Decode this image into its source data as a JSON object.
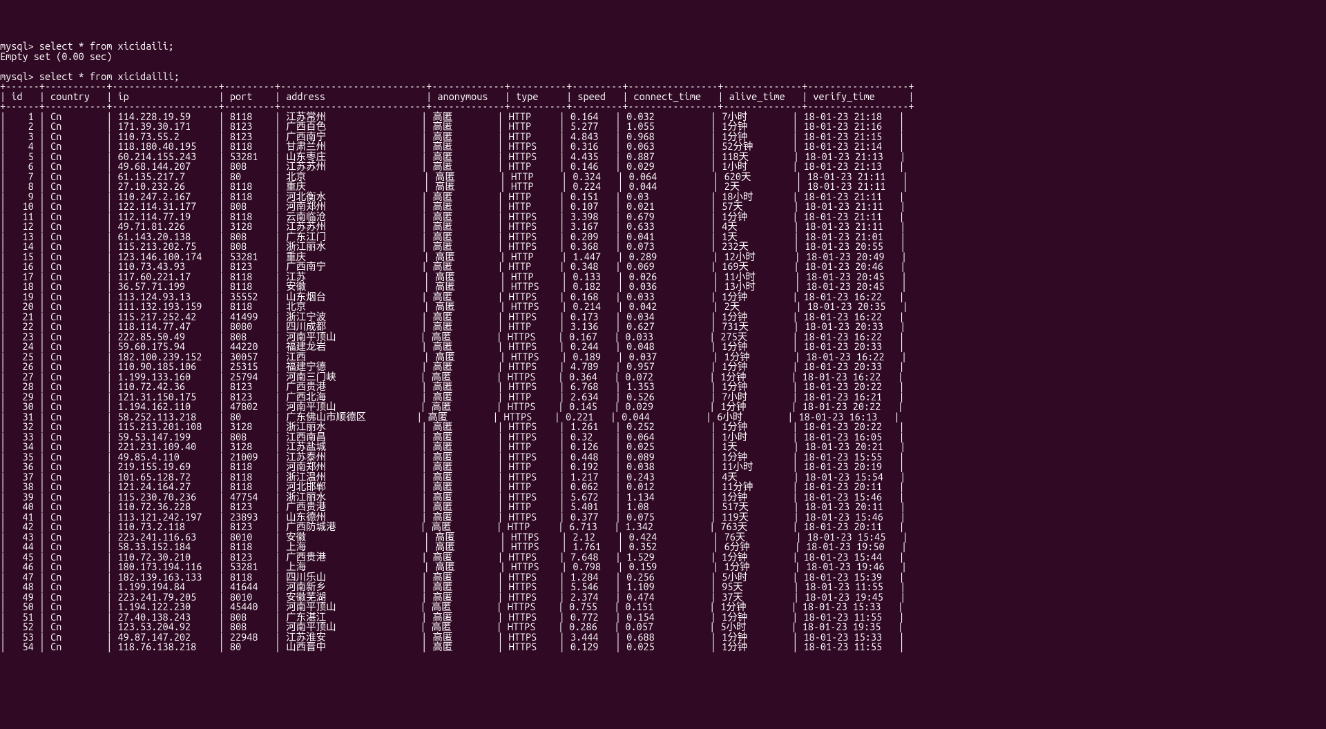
{
  "prompt1": "mysql> select * from xicidaili;",
  "result1": "Empty set (0.00 sec)",
  "blank": "",
  "prompt2": "mysql> select * from xicidailli;",
  "columns": [
    "id",
    "country",
    "ip",
    "port",
    "address",
    "anonymous",
    "type",
    "speed",
    "connect_time",
    "alive_time",
    "verify_time"
  ],
  "widths": {
    "id": 4,
    "country": 9,
    "ip": 17,
    "port": 7,
    "address": 24,
    "anonymous": 11,
    "type": 8,
    "speed": 7,
    "connect_time": 14,
    "alive_time": 12,
    "verify_time": 16
  },
  "rows": [
    {
      "id": "1",
      "country": "Cn",
      "ip": "114.228.19.59",
      "port": "8118",
      "address": "江苏常州",
      "anonymous": "高匿",
      "type": "HTTP",
      "speed": "0.164",
      "connect_time": "0.032",
      "alive_time": "7小时",
      "verify_time": "18-01-23 21:18"
    },
    {
      "id": "2",
      "country": "Cn",
      "ip": "171.39.30.171",
      "port": "8123",
      "address": "广西百色",
      "anonymous": "高匿",
      "type": "HTTP",
      "speed": "5.277",
      "connect_time": "1.055",
      "alive_time": "1分钟",
      "verify_time": "18-01-23 21:16"
    },
    {
      "id": "3",
      "country": "Cn",
      "ip": "110.73.55.2",
      "port": "8123",
      "address": "广西南宁",
      "anonymous": "高匿",
      "type": "HTTP",
      "speed": "4.843",
      "connect_time": "0.968",
      "alive_time": "1分钟",
      "verify_time": "18-01-23 21:15"
    },
    {
      "id": "4",
      "country": "Cn",
      "ip": "118.180.40.195",
      "port": "8118",
      "address": "甘肃兰州",
      "anonymous": "高匿",
      "type": "HTTPS",
      "speed": "0.316",
      "connect_time": "0.063",
      "alive_time": "52分钟",
      "verify_time": "18-01-23 21:14"
    },
    {
      "id": "5",
      "country": "Cn",
      "ip": "60.214.155.243",
      "port": "53281",
      "address": "山东枣庄",
      "anonymous": "高匿",
      "type": "HTTPS",
      "speed": "4.435",
      "connect_time": "0.887",
      "alive_time": "118天",
      "verify_time": "18-01-23 21:13"
    },
    {
      "id": "6",
      "country": "Cn",
      "ip": "49.68.144.207",
      "port": "808",
      "address": "江苏苏州",
      "anonymous": "高匿",
      "type": "HTTP",
      "speed": "0.146",
      "connect_time": "0.029",
      "alive_time": "1小时",
      "verify_time": "18-01-23 21:13"
    },
    {
      "id": "7",
      "country": "Cn",
      "ip": "61.135.217.7",
      "port": "80",
      "address": "北京",
      "anonymous": "高匿",
      "type": "HTTP",
      "speed": "0.324",
      "connect_time": "0.064",
      "alive_time": "620天",
      "verify_time": "18-01-23 21:11"
    },
    {
      "id": "8",
      "country": "Cn",
      "ip": "27.10.232.26",
      "port": "8118",
      "address": "重庆",
      "anonymous": "高匿",
      "type": "HTTP",
      "speed": "0.224",
      "connect_time": "0.044",
      "alive_time": "2天",
      "verify_time": "18-01-23 21:11"
    },
    {
      "id": "9",
      "country": "Cn",
      "ip": "110.247.2.167",
      "port": "8118",
      "address": "河北衡水",
      "anonymous": "高匿",
      "type": "HTTP",
      "speed": "0.151",
      "connect_time": "0.03",
      "alive_time": "18小时",
      "verify_time": "18-01-23 21:11"
    },
    {
      "id": "10",
      "country": "Cn",
      "ip": "122.114.31.177",
      "port": "808",
      "address": "河南郑州",
      "anonymous": "高匿",
      "type": "HTTP",
      "speed": "0.107",
      "connect_time": "0.021",
      "alive_time": "57天",
      "verify_time": "18-01-23 21:11"
    },
    {
      "id": "11",
      "country": "Cn",
      "ip": "112.114.77.19",
      "port": "8118",
      "address": "云南临沧",
      "anonymous": "高匿",
      "type": "HTTPS",
      "speed": "3.398",
      "connect_time": "0.679",
      "alive_time": "1分钟",
      "verify_time": "18-01-23 21:11"
    },
    {
      "id": "12",
      "country": "Cn",
      "ip": "49.71.81.226",
      "port": "3128",
      "address": "江苏苏州",
      "anonymous": "高匿",
      "type": "HTTPS",
      "speed": "3.167",
      "connect_time": "0.633",
      "alive_time": "4天",
      "verify_time": "18-01-23 21:11"
    },
    {
      "id": "13",
      "country": "Cn",
      "ip": "61.143.20.138",
      "port": "808",
      "address": "广东江门",
      "anonymous": "高匿",
      "type": "HTTPS",
      "speed": "0.209",
      "connect_time": "0.041",
      "alive_time": "1天",
      "verify_time": "18-01-23 21:01"
    },
    {
      "id": "14",
      "country": "Cn",
      "ip": "115.213.202.75",
      "port": "808",
      "address": "浙江丽水",
      "anonymous": "高匿",
      "type": "HTTPS",
      "speed": "0.368",
      "connect_time": "0.073",
      "alive_time": "232天",
      "verify_time": "18-01-23 20:55"
    },
    {
      "id": "15",
      "country": "Cn",
      "ip": "123.146.100.174",
      "port": "53281",
      "address": "重庆",
      "anonymous": "高匿",
      "type": "HTTP",
      "speed": "1.447",
      "connect_time": "0.289",
      "alive_time": "12小时",
      "verify_time": "18-01-23 20:49"
    },
    {
      "id": "16",
      "country": "Cn",
      "ip": "110.73.43.93",
      "port": "8123",
      "address": "广西南宁",
      "anonymous": "高匿",
      "type": "HTTP",
      "speed": "0.348",
      "connect_time": "0.069",
      "alive_time": "169天",
      "verify_time": "18-01-23 20:46"
    },
    {
      "id": "17",
      "country": "Cn",
      "ip": "117.60.221.17",
      "port": "8118",
      "address": "江苏",
      "anonymous": "高匿",
      "type": "HTTP",
      "speed": "0.133",
      "connect_time": "0.026",
      "alive_time": "11小时",
      "verify_time": "18-01-23 20:45"
    },
    {
      "id": "18",
      "country": "Cn",
      "ip": "36.57.71.199",
      "port": "8118",
      "address": "安徽",
      "anonymous": "高匿",
      "type": "HTTPS",
      "speed": "0.182",
      "connect_time": "0.036",
      "alive_time": "13小时",
      "verify_time": "18-01-23 20:45"
    },
    {
      "id": "19",
      "country": "Cn",
      "ip": "113.124.93.13",
      "port": "35552",
      "address": "山东烟台",
      "anonymous": "高匿",
      "type": "HTTPS",
      "speed": "0.168",
      "connect_time": "0.033",
      "alive_time": "1分钟",
      "verify_time": "18-01-23 16:22"
    },
    {
      "id": "20",
      "country": "Cn",
      "ip": "111.132.193.159",
      "port": "8118",
      "address": "北京",
      "anonymous": "高匿",
      "type": "HTTPS",
      "speed": "0.214",
      "connect_time": "0.042",
      "alive_time": "2天",
      "verify_time": "18-01-23 20:35"
    },
    {
      "id": "21",
      "country": "Cn",
      "ip": "115.217.252.42",
      "port": "41499",
      "address": "浙江宁波",
      "anonymous": "高匿",
      "type": "HTTPS",
      "speed": "0.173",
      "connect_time": "0.034",
      "alive_time": "1分钟",
      "verify_time": "18-01-23 16:22"
    },
    {
      "id": "22",
      "country": "Cn",
      "ip": "118.114.77.47",
      "port": "8080",
      "address": "四川成都",
      "anonymous": "高匿",
      "type": "HTTP",
      "speed": "3.136",
      "connect_time": "0.627",
      "alive_time": "731天",
      "verify_time": "18-01-23 20:33"
    },
    {
      "id": "23",
      "country": "Cn",
      "ip": "222.85.50.49",
      "port": "808",
      "address": "河南平顶山",
      "anonymous": "高匿",
      "type": "HTTPS",
      "speed": "0.167",
      "connect_time": "0.033",
      "alive_time": "275天",
      "verify_time": "18-01-23 16:22"
    },
    {
      "id": "24",
      "country": "Cn",
      "ip": "59.60.175.94",
      "port": "44220",
      "address": "福建龙岩",
      "anonymous": "高匿",
      "type": "HTTPS",
      "speed": "0.244",
      "connect_time": "0.048",
      "alive_time": "1分钟",
      "verify_time": "18-01-23 20:33"
    },
    {
      "id": "25",
      "country": "Cn",
      "ip": "182.100.239.152",
      "port": "30057",
      "address": "江西",
      "anonymous": "高匿",
      "type": "HTTPS",
      "speed": "0.189",
      "connect_time": "0.037",
      "alive_time": "1分钟",
      "verify_time": "18-01-23 16:22"
    },
    {
      "id": "26",
      "country": "Cn",
      "ip": "110.90.185.106",
      "port": "25315",
      "address": "福建宁德",
      "anonymous": "高匿",
      "type": "HTTPS",
      "speed": "4.789",
      "connect_time": "0.957",
      "alive_time": "1分钟",
      "verify_time": "18-01-23 20:33"
    },
    {
      "id": "27",
      "country": "Cn",
      "ip": "1.199.133.160",
      "port": "25794",
      "address": "河南三门峡",
      "anonymous": "高匿",
      "type": "HTTPS",
      "speed": "0.364",
      "connect_time": "0.072",
      "alive_time": "1分钟",
      "verify_time": "18-01-23 16:22"
    },
    {
      "id": "28",
      "country": "Cn",
      "ip": "110.72.42.36",
      "port": "8123",
      "address": "广西贵港",
      "anonymous": "高匿",
      "type": "HTTPS",
      "speed": "6.768",
      "connect_time": "1.353",
      "alive_time": "1分钟",
      "verify_time": "18-01-23 20:22"
    },
    {
      "id": "29",
      "country": "Cn",
      "ip": "121.31.150.175",
      "port": "8123",
      "address": "广西北海",
      "anonymous": "高匿",
      "type": "HTTP",
      "speed": "2.634",
      "connect_time": "0.526",
      "alive_time": "7小时",
      "verify_time": "18-01-23 16:21"
    },
    {
      "id": "30",
      "country": "Cn",
      "ip": "1.194.162.110",
      "port": "47802",
      "address": "河南平顶山",
      "anonymous": "高匿",
      "type": "HTTPS",
      "speed": "0.145",
      "connect_time": "0.029",
      "alive_time": "1分钟",
      "verify_time": "18-01-23 20:22"
    },
    {
      "id": "31",
      "country": "Cn",
      "ip": "58.252.113.218",
      "port": "80",
      "address": "广东佛山市顺德区",
      "anonymous": "高匿",
      "type": "HTTPS",
      "speed": "0.221",
      "connect_time": "0.044",
      "alive_time": "6小时",
      "verify_time": "18-01-23 16:13"
    },
    {
      "id": "32",
      "country": "Cn",
      "ip": "115.213.201.108",
      "port": "3128",
      "address": "浙江丽水",
      "anonymous": "高匿",
      "type": "HTTPS",
      "speed": "1.261",
      "connect_time": "0.252",
      "alive_time": "1分钟",
      "verify_time": "18-01-23 20:22"
    },
    {
      "id": "33",
      "country": "Cn",
      "ip": "59.53.147.199",
      "port": "808",
      "address": "江西南昌",
      "anonymous": "高匿",
      "type": "HTTPS",
      "speed": "0.32",
      "connect_time": "0.064",
      "alive_time": "1小时",
      "verify_time": "18-01-23 16:05"
    },
    {
      "id": "34",
      "country": "Cn",
      "ip": "221.231.109.40",
      "port": "3128",
      "address": "江苏盐城",
      "anonymous": "高匿",
      "type": "HTTP",
      "speed": "0.126",
      "connect_time": "0.025",
      "alive_time": "1天",
      "verify_time": "18-01-23 20:21"
    },
    {
      "id": "35",
      "country": "Cn",
      "ip": "49.85.4.110",
      "port": "21009",
      "address": "江苏泰州",
      "anonymous": "高匿",
      "type": "HTTPS",
      "speed": "0.448",
      "connect_time": "0.089",
      "alive_time": "1分钟",
      "verify_time": "18-01-23 15:55"
    },
    {
      "id": "36",
      "country": "Cn",
      "ip": "219.155.19.69",
      "port": "8118",
      "address": "河南郑州",
      "anonymous": "高匿",
      "type": "HTTP",
      "speed": "0.192",
      "connect_time": "0.038",
      "alive_time": "11小时",
      "verify_time": "18-01-23 20:19"
    },
    {
      "id": "37",
      "country": "Cn",
      "ip": "101.65.128.72",
      "port": "8118",
      "address": "浙江温州",
      "anonymous": "高匿",
      "type": "HTTPS",
      "speed": "1.217",
      "connect_time": "0.243",
      "alive_time": "4天",
      "verify_time": "18-01-23 15:54"
    },
    {
      "id": "38",
      "country": "Cn",
      "ip": "121.24.164.27",
      "port": "8118",
      "address": "河北邯郸",
      "anonymous": "高匿",
      "type": "HTTP",
      "speed": "0.062",
      "connect_time": "0.012",
      "alive_time": "11分钟",
      "verify_time": "18-01-23 20:11"
    },
    {
      "id": "39",
      "country": "Cn",
      "ip": "115.230.70.236",
      "port": "47754",
      "address": "浙江丽水",
      "anonymous": "高匿",
      "type": "HTTPS",
      "speed": "5.672",
      "connect_time": "1.134",
      "alive_time": "1分钟",
      "verify_time": "18-01-23 15:46"
    },
    {
      "id": "40",
      "country": "Cn",
      "ip": "110.72.36.228",
      "port": "8123",
      "address": "广西贵港",
      "anonymous": "高匿",
      "type": "HTTP",
      "speed": "5.401",
      "connect_time": "1.08",
      "alive_time": "517天",
      "verify_time": "18-01-23 20:11"
    },
    {
      "id": "41",
      "country": "Cn",
      "ip": "113.121.242.197",
      "port": "23893",
      "address": "山东德州",
      "anonymous": "高匿",
      "type": "HTTPS",
      "speed": "0.377",
      "connect_time": "0.075",
      "alive_time": "119天",
      "verify_time": "18-01-23 15:46"
    },
    {
      "id": "42",
      "country": "Cn",
      "ip": "110.73.2.118",
      "port": "8123",
      "address": "广西防城港",
      "anonymous": "高匿",
      "type": "HTTP",
      "speed": "6.713",
      "connect_time": "1.342",
      "alive_time": "763天",
      "verify_time": "18-01-23 20:11"
    },
    {
      "id": "43",
      "country": "Cn",
      "ip": "223.241.116.63",
      "port": "8010",
      "address": "安徽",
      "anonymous": "高匿",
      "type": "HTTPS",
      "speed": "2.12",
      "connect_time": "0.424",
      "alive_time": "76天",
      "verify_time": "18-01-23 15:45"
    },
    {
      "id": "44",
      "country": "Cn",
      "ip": "58.33.152.184",
      "port": "8118",
      "address": "上海",
      "anonymous": "高匿",
      "type": "HTTPS",
      "speed": "1.761",
      "connect_time": "0.352",
      "alive_time": "6分钟",
      "verify_time": "18-01-23 19:50"
    },
    {
      "id": "45",
      "country": "Cn",
      "ip": "110.72.30.210",
      "port": "8123",
      "address": "广西贵港",
      "anonymous": "高匿",
      "type": "HTTPS",
      "speed": "7.648",
      "connect_time": "1.529",
      "alive_time": "1分钟",
      "verify_time": "18-01-23 15:44"
    },
    {
      "id": "46",
      "country": "Cn",
      "ip": "180.173.194.116",
      "port": "53281",
      "address": "上海",
      "anonymous": "高匿",
      "type": "HTTPS",
      "speed": "0.798",
      "connect_time": "0.159",
      "alive_time": "1分钟",
      "verify_time": "18-01-23 19:46"
    },
    {
      "id": "47",
      "country": "Cn",
      "ip": "182.139.163.133",
      "port": "8118",
      "address": "四川乐山",
      "anonymous": "高匿",
      "type": "HTTPS",
      "speed": "1.284",
      "connect_time": "0.256",
      "alive_time": "5小时",
      "verify_time": "18-01-23 15:39"
    },
    {
      "id": "48",
      "country": "Cn",
      "ip": "1.199.194.84",
      "port": "41644",
      "address": "河南新乡",
      "anonymous": "高匿",
      "type": "HTTPS",
      "speed": "5.546",
      "connect_time": "1.109",
      "alive_time": "95天",
      "verify_time": "18-01-23 11:55"
    },
    {
      "id": "49",
      "country": "Cn",
      "ip": "223.241.79.205",
      "port": "8010",
      "address": "安徽芜湖",
      "anonymous": "高匿",
      "type": "HTTPS",
      "speed": "2.374",
      "connect_time": "0.474",
      "alive_time": "37天",
      "verify_time": "18-01-23 19:45"
    },
    {
      "id": "50",
      "country": "Cn",
      "ip": "1.194.122.230",
      "port": "45440",
      "address": "河南平顶山",
      "anonymous": "高匿",
      "type": "HTTPS",
      "speed": "0.755",
      "connect_time": "0.151",
      "alive_time": "1分钟",
      "verify_time": "18-01-23 15:33"
    },
    {
      "id": "51",
      "country": "Cn",
      "ip": "27.40.138.243",
      "port": "808",
      "address": "广东湛江",
      "anonymous": "高匿",
      "type": "HTTPS",
      "speed": "0.772",
      "connect_time": "0.154",
      "alive_time": "1分钟",
      "verify_time": "18-01-23 11:55"
    },
    {
      "id": "52",
      "country": "Cn",
      "ip": "123.53.204.92",
      "port": "808",
      "address": "河南平顶山",
      "anonymous": "高匿",
      "type": "HTTPS",
      "speed": "0.286",
      "connect_time": "0.057",
      "alive_time": "5小时",
      "verify_time": "18-01-23 19:35"
    },
    {
      "id": "53",
      "country": "Cn",
      "ip": "49.87.147.202",
      "port": "22948",
      "address": "江苏淮安",
      "anonymous": "高匿",
      "type": "HTTPS",
      "speed": "3.444",
      "connect_time": "0.688",
      "alive_time": "1分钟",
      "verify_time": "18-01-23 15:33"
    },
    {
      "id": "54",
      "country": "Cn",
      "ip": "118.76.138.218",
      "port": "80",
      "address": "山西晋中",
      "anonymous": "高匿",
      "type": "HTTPS",
      "speed": "0.129",
      "connect_time": "0.025",
      "alive_time": "1分钟",
      "verify_time": "18-01-23 11:55"
    }
  ]
}
